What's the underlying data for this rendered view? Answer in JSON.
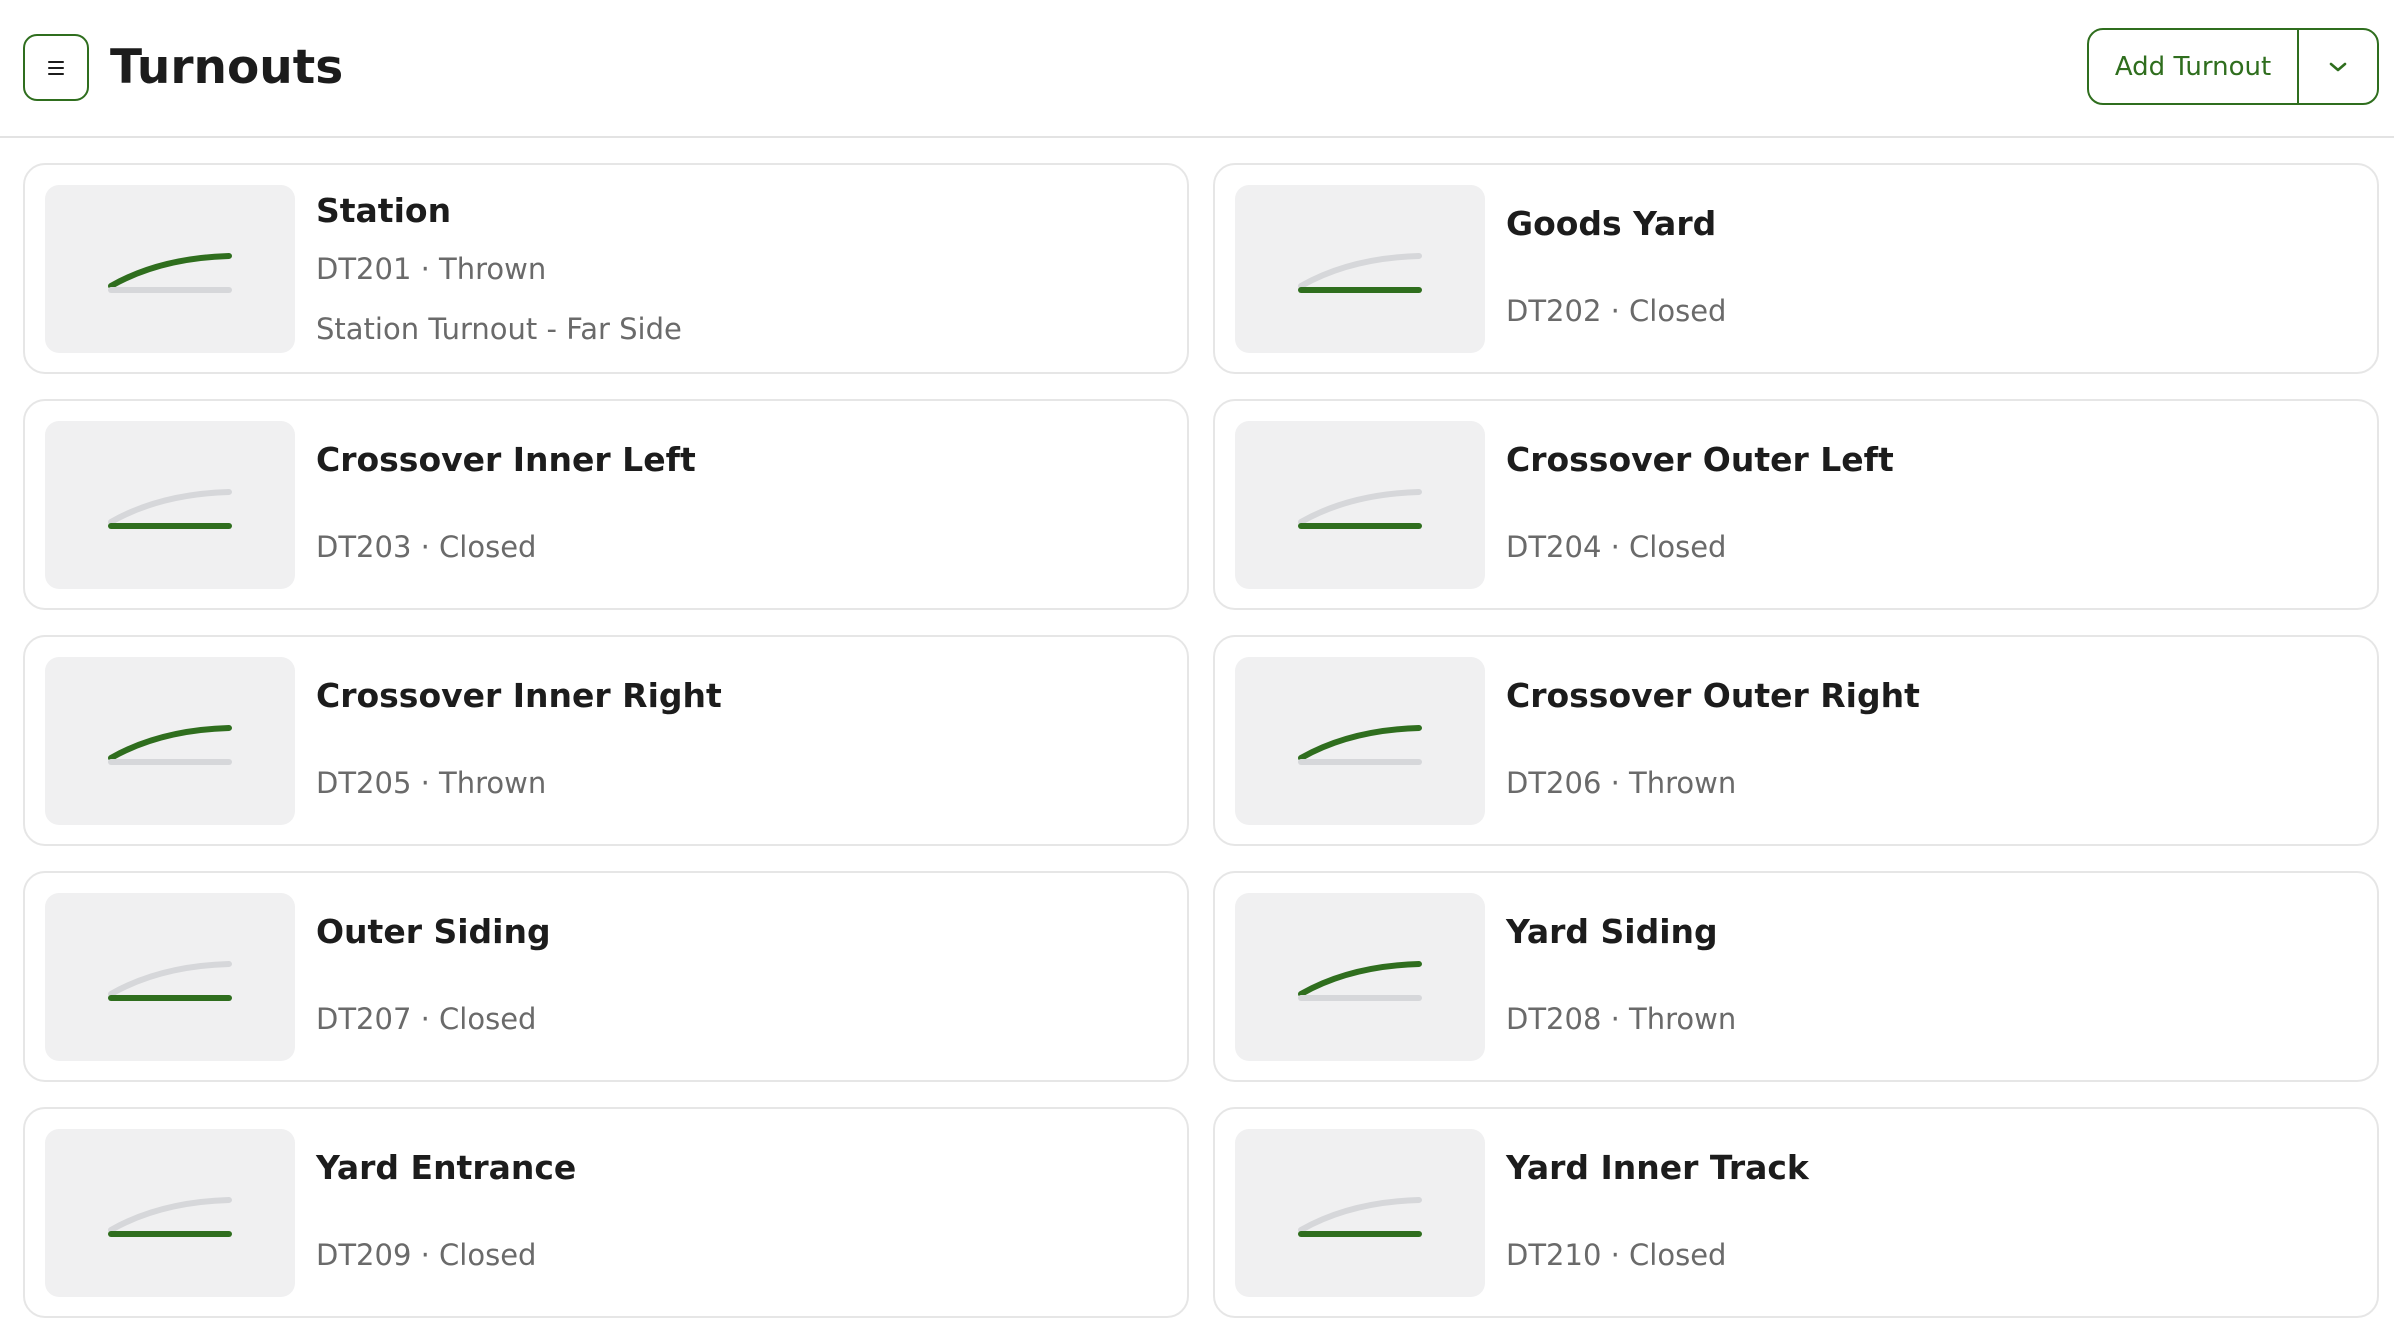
{
  "header": {
    "title": "Turnouts",
    "add_button_label": "Add Turnout",
    "menu_icon": "hamburger-icon",
    "dropdown_icon": "chevron-down-icon"
  },
  "colors": {
    "accent": "#2f6e1e",
    "track_inactive": "#d6d7da",
    "thumb_bg": "#f0f0f1"
  },
  "turnouts": [
    {
      "name": "Station",
      "meta": "DT201 · Thrown",
      "description": "Station Turnout - Far Side",
      "state": "thrown"
    },
    {
      "name": "Goods Yard",
      "meta": "DT202 · Closed",
      "state": "closed"
    },
    {
      "name": "Crossover Inner Left",
      "meta": "DT203 · Closed",
      "state": "closed"
    },
    {
      "name": "Crossover Outer Left",
      "meta": "DT204 · Closed",
      "state": "closed"
    },
    {
      "name": "Crossover Inner Right",
      "meta": "DT205 · Thrown",
      "state": "thrown"
    },
    {
      "name": "Crossover Outer Right",
      "meta": "DT206 · Thrown",
      "state": "thrown"
    },
    {
      "name": "Outer Siding",
      "meta": "DT207 · Closed",
      "state": "closed"
    },
    {
      "name": "Yard Siding",
      "meta": "DT208 · Thrown",
      "state": "thrown"
    },
    {
      "name": "Yard Entrance",
      "meta": "DT209 · Closed",
      "state": "closed"
    },
    {
      "name": "Yard Inner Track",
      "meta": "DT210 · Closed",
      "state": "closed"
    }
  ]
}
